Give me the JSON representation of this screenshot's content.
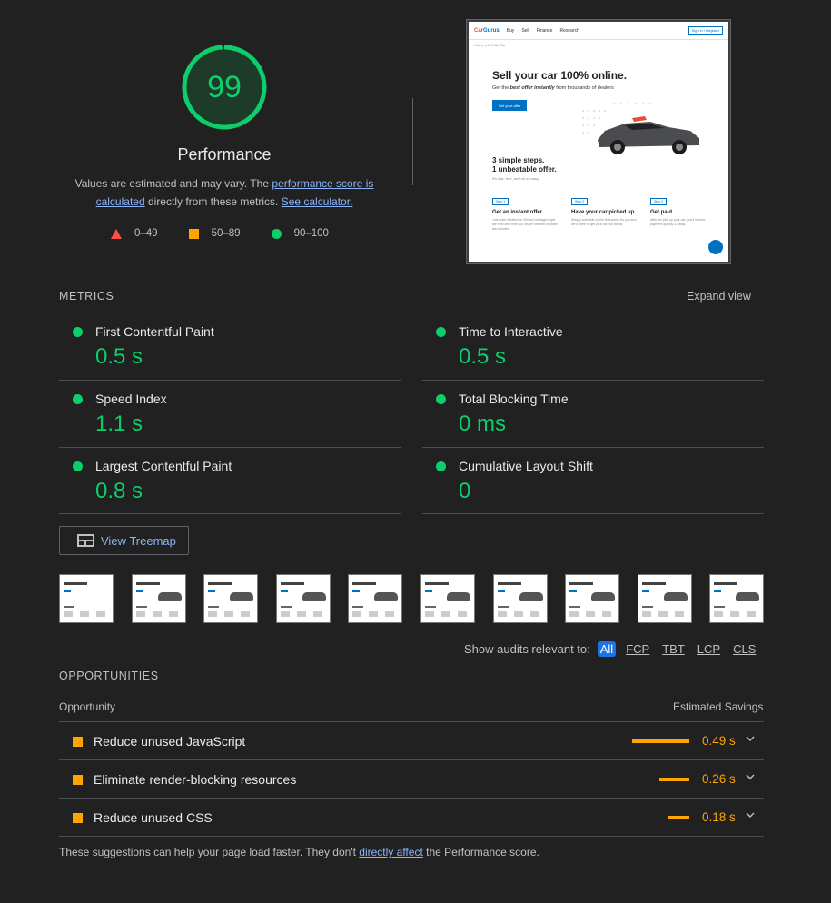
{
  "score": {
    "value": "99",
    "color": "#0cce6b",
    "fraction": 0.99
  },
  "title": "Performance",
  "description": {
    "prefix": "Values are estimated and may vary. The ",
    "link1": "performance score is calculated",
    "middle": " directly from these metrics. ",
    "link2": "See calculator."
  },
  "legend": [
    {
      "icon": "triangle-icon",
      "label": "0–49",
      "color": "#ff4e42"
    },
    {
      "icon": "square-icon",
      "label": "50–89",
      "color": "#ffa400"
    },
    {
      "icon": "circle-icon",
      "label": "90–100",
      "color": "#0cce6b"
    }
  ],
  "screenshot": {
    "logo_a": "Car",
    "logo_b": "Gurus",
    "nav": [
      "Buy",
      "Sell",
      "Finance",
      "Research"
    ],
    "signin": "Sign in / Register",
    "crumb": "Home  |  Sell My Car",
    "headline": "Sell your car 100% online.",
    "sub_a": "Get the ",
    "sub_em": "best offer instantly",
    "sub_b": " from thousands of dealers",
    "cta": "Get your offer",
    "steps_title_1": "3 simple steps.",
    "steps_title_2": "1 unbeatable offer.",
    "steps_sub": "It's fast, free, and oh so easy.",
    "cols": [
      {
        "tag": "Step 1",
        "title": "Get an instant offer",
        "text": "Just enter details like VIN and mileage to get the best offer from our dealer network in under two minutes."
      },
      {
        "tag": "Step 2",
        "title": "Have your car picked up",
        "text": "Simply schedule a time that works for you and we'll come to get your car. No sweat."
      },
      {
        "tag": "Step 3",
        "title": "Get paid",
        "text": "After we pick up your car, you'll receive payment quickly & easily."
      }
    ]
  },
  "metrics_label": "METRICS",
  "expand_label": "Expand view",
  "metrics": [
    {
      "name": "First Contentful Paint",
      "value": "0.5 s"
    },
    {
      "name": "Time to Interactive",
      "value": "0.5 s"
    },
    {
      "name": "Speed Index",
      "value": "1.1 s"
    },
    {
      "name": "Total Blocking Time",
      "value": "0 ms"
    },
    {
      "name": "Largest Contentful Paint",
      "value": "0.8 s"
    },
    {
      "name": "Cumulative Layout Shift",
      "value": "0"
    }
  ],
  "treemap_label": "View Treemap",
  "filmstrip_count": 10,
  "audit_filter": {
    "label": "Show audits relevant to:",
    "chips": [
      "All",
      "FCP",
      "TBT",
      "LCP",
      "CLS"
    ],
    "active": "All"
  },
  "opportunities_label": "OPPORTUNITIES",
  "opp_header": {
    "left": "Opportunity",
    "right": "Estimated Savings"
  },
  "opportunities": [
    {
      "name": "Reduce unused JavaScript",
      "savings": "0.49 s",
      "seconds": 0.49
    },
    {
      "name": "Eliminate render-blocking resources",
      "savings": "0.26 s",
      "seconds": 0.26
    },
    {
      "name": "Reduce unused CSS",
      "savings": "0.18 s",
      "seconds": 0.18
    }
  ],
  "footer": {
    "prefix": "These suggestions can help your page load faster. They don't ",
    "link": "directly affect",
    "suffix": " the Performance score."
  },
  "colors": {
    "pass": "#0cce6b",
    "average": "#ffa400",
    "fail": "#ff4e42",
    "link": "#8ab4f8",
    "active_chip": "#1a73e8"
  }
}
